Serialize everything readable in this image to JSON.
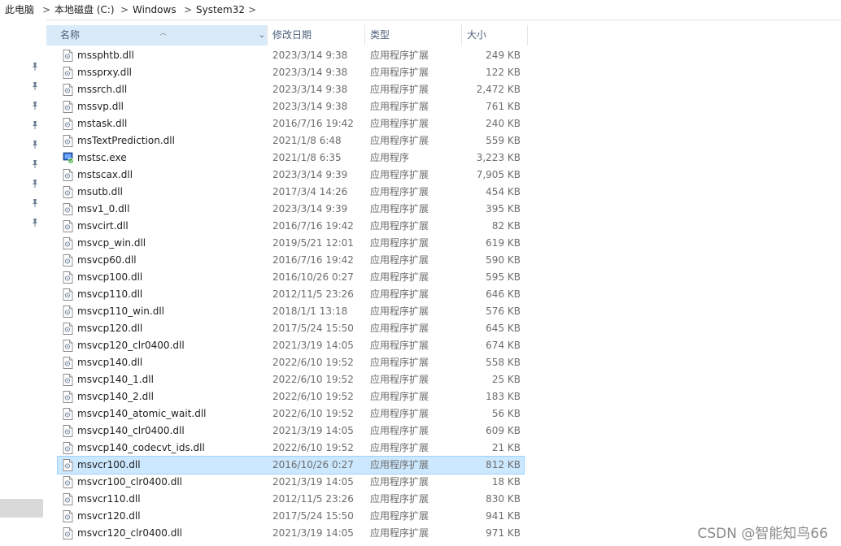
{
  "breadcrumb": [
    "此电脑",
    "本地磁盘 (C:)",
    "Windows",
    "System32"
  ],
  "breadcrumb_separator": ">",
  "columns": {
    "name": "名称",
    "date": "修改日期",
    "type": "类型",
    "size": "大小"
  },
  "pinned_count": 9,
  "selected_index": 24,
  "files": [
    {
      "name": "mssphtb.dll",
      "date": "2023/3/14 9:38",
      "type": "应用程序扩展",
      "size": "249 KB",
      "icon": "dll"
    },
    {
      "name": "mssprxy.dll",
      "date": "2023/3/14 9:38",
      "type": "应用程序扩展",
      "size": "122 KB",
      "icon": "dll"
    },
    {
      "name": "mssrch.dll",
      "date": "2023/3/14 9:38",
      "type": "应用程序扩展",
      "size": "2,472 KB",
      "icon": "dll"
    },
    {
      "name": "mssvp.dll",
      "date": "2023/3/14 9:38",
      "type": "应用程序扩展",
      "size": "761 KB",
      "icon": "dll"
    },
    {
      "name": "mstask.dll",
      "date": "2016/7/16 19:42",
      "type": "应用程序扩展",
      "size": "240 KB",
      "icon": "dll"
    },
    {
      "name": "msTextPrediction.dll",
      "date": "2021/1/8 6:48",
      "type": "应用程序扩展",
      "size": "559 KB",
      "icon": "dll"
    },
    {
      "name": "mstsc.exe",
      "date": "2021/1/8 6:35",
      "type": "应用程序",
      "size": "3,223 KB",
      "icon": "exe"
    },
    {
      "name": "mstscax.dll",
      "date": "2023/3/14 9:39",
      "type": "应用程序扩展",
      "size": "7,905 KB",
      "icon": "dll"
    },
    {
      "name": "msutb.dll",
      "date": "2017/3/4 14:26",
      "type": "应用程序扩展",
      "size": "454 KB",
      "icon": "dll"
    },
    {
      "name": "msv1_0.dll",
      "date": "2023/3/14 9:39",
      "type": "应用程序扩展",
      "size": "395 KB",
      "icon": "dll"
    },
    {
      "name": "msvcirt.dll",
      "date": "2016/7/16 19:42",
      "type": "应用程序扩展",
      "size": "82 KB",
      "icon": "dll"
    },
    {
      "name": "msvcp_win.dll",
      "date": "2019/5/21 12:01",
      "type": "应用程序扩展",
      "size": "619 KB",
      "icon": "dll"
    },
    {
      "name": "msvcp60.dll",
      "date": "2016/7/16 19:42",
      "type": "应用程序扩展",
      "size": "590 KB",
      "icon": "dll"
    },
    {
      "name": "msvcp100.dll",
      "date": "2016/10/26 0:27",
      "type": "应用程序扩展",
      "size": "595 KB",
      "icon": "dll"
    },
    {
      "name": "msvcp110.dll",
      "date": "2012/11/5 23:26",
      "type": "应用程序扩展",
      "size": "646 KB",
      "icon": "dll"
    },
    {
      "name": "msvcp110_win.dll",
      "date": "2018/1/1 13:18",
      "type": "应用程序扩展",
      "size": "576 KB",
      "icon": "dll"
    },
    {
      "name": "msvcp120.dll",
      "date": "2017/5/24 15:50",
      "type": "应用程序扩展",
      "size": "645 KB",
      "icon": "dll"
    },
    {
      "name": "msvcp120_clr0400.dll",
      "date": "2021/3/19 14:05",
      "type": "应用程序扩展",
      "size": "674 KB",
      "icon": "dll"
    },
    {
      "name": "msvcp140.dll",
      "date": "2022/6/10 19:52",
      "type": "应用程序扩展",
      "size": "558 KB",
      "icon": "dll"
    },
    {
      "name": "msvcp140_1.dll",
      "date": "2022/6/10 19:52",
      "type": "应用程序扩展",
      "size": "25 KB",
      "icon": "dll"
    },
    {
      "name": "msvcp140_2.dll",
      "date": "2022/6/10 19:52",
      "type": "应用程序扩展",
      "size": "183 KB",
      "icon": "dll"
    },
    {
      "name": "msvcp140_atomic_wait.dll",
      "date": "2022/6/10 19:52",
      "type": "应用程序扩展",
      "size": "56 KB",
      "icon": "dll"
    },
    {
      "name": "msvcp140_clr0400.dll",
      "date": "2021/3/19 14:05",
      "type": "应用程序扩展",
      "size": "609 KB",
      "icon": "dll"
    },
    {
      "name": "msvcp140_codecvt_ids.dll",
      "date": "2022/6/10 19:52",
      "type": "应用程序扩展",
      "size": "21 KB",
      "icon": "dll"
    },
    {
      "name": "msvcr100.dll",
      "date": "2016/10/26 0:27",
      "type": "应用程序扩展",
      "size": "812 KB",
      "icon": "dll"
    },
    {
      "name": "msvcr100_clr0400.dll",
      "date": "2021/3/19 14:05",
      "type": "应用程序扩展",
      "size": "18 KB",
      "icon": "dll"
    },
    {
      "name": "msvcr110.dll",
      "date": "2012/11/5 23:26",
      "type": "应用程序扩展",
      "size": "830 KB",
      "icon": "dll"
    },
    {
      "name": "msvcr120.dll",
      "date": "2017/5/24 15:50",
      "type": "应用程序扩展",
      "size": "941 KB",
      "icon": "dll"
    },
    {
      "name": "msvcr120_clr0400.dll",
      "date": "2021/3/19 14:05",
      "type": "应用程序扩展",
      "size": "971 KB",
      "icon": "dll"
    }
  ],
  "watermark": "CSDN @智能知鸟66",
  "colors": {
    "selection_bg": "#cce8ff",
    "selection_border": "#99d1ff",
    "header_active_bg": "#d9ebf9",
    "header_text": "#4c607a"
  }
}
